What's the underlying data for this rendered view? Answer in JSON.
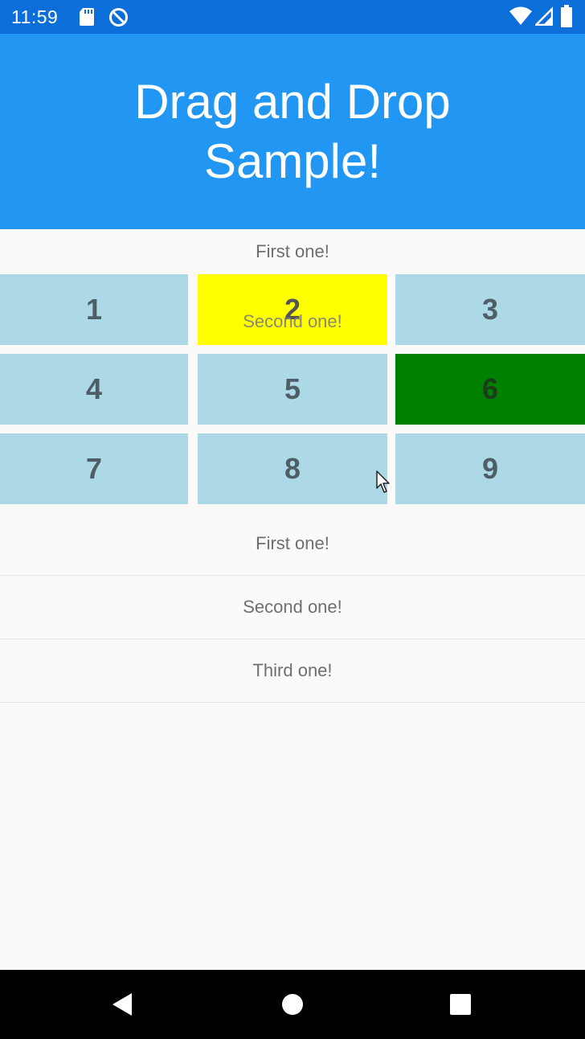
{
  "status_bar": {
    "time": "11:59",
    "icons": [
      "sd-card-icon",
      "do-not-disturb-icon",
      "wifi-icon",
      "signal-icon",
      "battery-icon"
    ]
  },
  "header": {
    "title": "Drag and Drop Sample!",
    "background": "#2196f3"
  },
  "drop_target_label": "First one!",
  "grid": {
    "cells": [
      "1",
      "2",
      "3",
      "4",
      "5",
      "6",
      "7",
      "8",
      "9"
    ],
    "cell_color": "#add8e6",
    "highlighted": {
      "2": "#ffff00",
      "6": "#008000"
    }
  },
  "drag_ghost_label": "Second one!",
  "list": {
    "items": [
      "First one!",
      "Second one!",
      "Third one!"
    ]
  },
  "nav_bar": {
    "buttons": [
      "back-icon",
      "home-icon",
      "recents-icon"
    ]
  }
}
